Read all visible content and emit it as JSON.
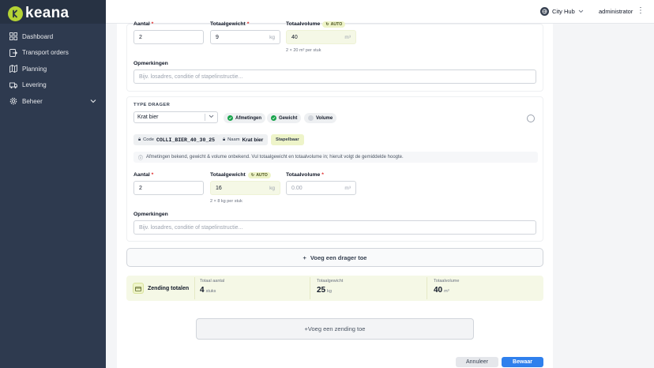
{
  "app": {
    "logo_text": "keana"
  },
  "sidebar": {
    "items": [
      {
        "label": "Dashboard",
        "icon": "grid-icon"
      },
      {
        "label": "Transport orders",
        "icon": "exit-icon"
      },
      {
        "label": "Planning",
        "icon": "map-icon"
      },
      {
        "label": "Levering",
        "icon": "truck-icon"
      },
      {
        "label": "Beheer",
        "icon": "gear-icon",
        "expandable": true
      }
    ]
  },
  "topbar": {
    "hub": "City Hub",
    "user": "administrator"
  },
  "carrier1": {
    "aantal_label": "Aantal",
    "aantal_value": "2",
    "gewicht_label": "Totaalgewicht",
    "gewicht_value": "9",
    "gewicht_unit": "kg",
    "volume_label": "Totaalvolume",
    "volume_badge": "AUTO",
    "volume_value": "40",
    "volume_unit": "m³",
    "volume_hint": "2 × 20 m³ per stuk",
    "opm_label": "Opmerkingen",
    "opm_placeholder": "Bijv. losadres, conditie of stapelinstructie..."
  },
  "carrier2": {
    "type_label": "TYPE DRAGER",
    "type_value": "Krat bier",
    "chips": [
      {
        "label": "Afmetingen",
        "checked": true
      },
      {
        "label": "Gewicht",
        "checked": true
      },
      {
        "label": "Volume",
        "checked": false
      }
    ],
    "code_label": "Code",
    "code_value": "COLLI_BIER_40_30_25",
    "naam_label": "Naam",
    "naam_value": "Krat bier",
    "stapelbaar": "Stapelbaar",
    "info": "Afmetingen bekend, gewicht & volume onbekend. Vul totaalgewicht en totaalvolume in; hieruit volgt de gemiddelde hoogte.",
    "aantal_label": "Aantal",
    "aantal_value": "2",
    "gewicht_label": "Totaalgewicht",
    "gewicht_badge": "AUTO",
    "gewicht_value": "16",
    "gewicht_unit": "kg",
    "gewicht_hint": "2 × 8 kg per stuk",
    "volume_label": "Totaalvolume",
    "volume_placeholder": "0.00",
    "volume_unit": "m³",
    "opm_label": "Opmerkingen",
    "opm_placeholder": "Bijv. losadres, conditie of stapelinstructie..."
  },
  "add_drager": "Voeg een drager toe",
  "totals": {
    "title": "Zending totalen",
    "aantal_label": "Totaal aantal",
    "aantal_value": "4",
    "aantal_unit": "stuks",
    "gewicht_label": "Totaalgewicht",
    "gewicht_value": "25",
    "gewicht_unit": "kg",
    "volume_label": "Totaalvolume",
    "volume_value": "40",
    "volume_unit": "m³"
  },
  "add_zending": "+Voeg een zending toe",
  "actions": {
    "cancel": "Annuleer",
    "save": "Bewaar"
  },
  "colors": {
    "sidebar": "#2e3a4f",
    "accent": "#b5d334",
    "primary": "#2f80ed",
    "auto_bg": "#f5f8e6"
  }
}
